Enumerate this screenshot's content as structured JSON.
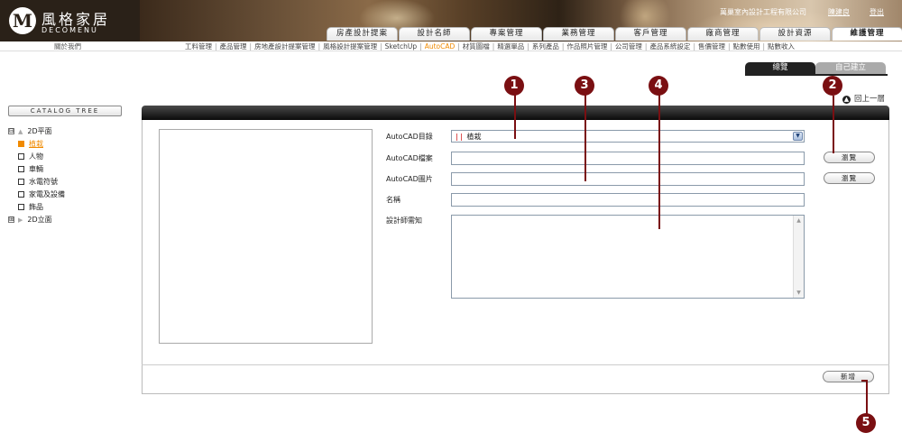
{
  "header": {
    "logo_badge": "M",
    "logo_title": "風格家居",
    "logo_sub": "DECOMENU",
    "company": "萬巢室內設計工程有限公司",
    "user": "陳建良",
    "logout": "登出"
  },
  "main_nav": [
    "房產設計提案",
    "設計名師",
    "專案管理",
    "業務管理",
    "客戶管理",
    "廠商管理",
    "設計資源",
    "維護管理"
  ],
  "main_nav_active": "維護管理",
  "subbar": {
    "about": "關於我們",
    "items": [
      "工料管理",
      "產品管理",
      "房地產設計提案管理",
      "風格設計提案管理",
      "SketchUp",
      "AutoCAD",
      "材質圖檔",
      "精選單品",
      "系列產品",
      "作品照片管理",
      "公司管理",
      "產品系統設定",
      "售價管理",
      "點數使用",
      "點數收入"
    ],
    "active": "AutoCAD"
  },
  "view_tabs": {
    "overview": "總覽",
    "setup": "自己建立"
  },
  "back_link": "回上一層",
  "sidebar": {
    "catalog_label": "CATALOG TREE",
    "tree": {
      "root1": "2D平面",
      "children": [
        "植栽",
        "人物",
        "車輛",
        "水電符號",
        "家電及設備",
        "飾品"
      ],
      "active": "植栽",
      "root2": "2D立面",
      "root1_expander": "⊟",
      "root2_expander": "⊞"
    }
  },
  "form": {
    "dir_label": "AutoCAD目錄",
    "dir_value": "植栽",
    "dir_prefix": "| |",
    "file_label": "AutoCAD檔案",
    "image_label": "AutoCAD圖片",
    "name_label": "名稱",
    "notes_label": "設計師需知",
    "browse_label": "瀏覽",
    "add_label": "新增"
  },
  "callouts": [
    "1",
    "2",
    "3",
    "4",
    "5"
  ],
  "colors": {
    "accent": "#f08a00",
    "callout": "#7a0f12",
    "header_dark": "#2a2118"
  }
}
